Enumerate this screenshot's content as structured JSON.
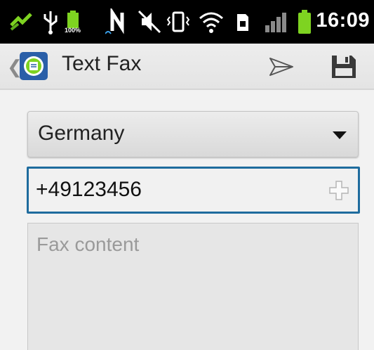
{
  "status_bar": {
    "time": "16:09",
    "battery_small_label": "100%",
    "icons": [
      "usb-debug-icon",
      "usb-icon",
      "battery-small-icon",
      "nfc-icon",
      "data-transfer-icon",
      "mute-icon",
      "vibrate-icon",
      "wifi-icon",
      "sim-icon",
      "signal-icon",
      "battery-icon"
    ]
  },
  "action_bar": {
    "title": "Text Fax",
    "up_icon": "chevron-left-icon",
    "app_icon": "fax-app-icon",
    "send_icon": "send-icon",
    "save_icon": "save-icon"
  },
  "form": {
    "country_selected": "Germany",
    "fax_number_value": "+49123456",
    "fax_number_placeholder": "",
    "content_value": "",
    "content_placeholder": "Fax content"
  },
  "colors": {
    "accent": "#1f6c9e",
    "status_bar_bg": "#000000",
    "battery_green": "#7ed321"
  }
}
